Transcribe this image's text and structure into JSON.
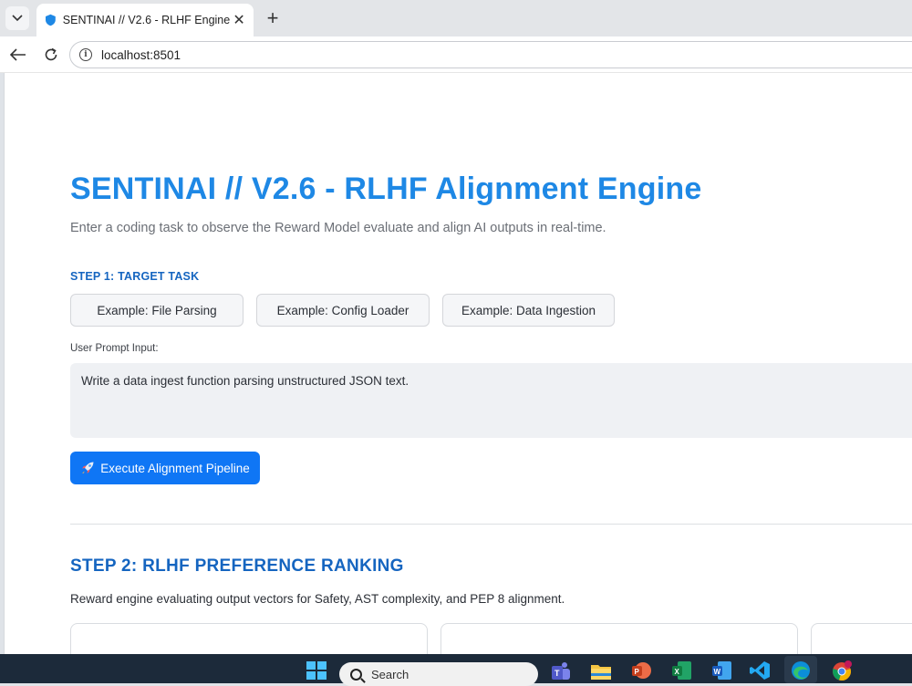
{
  "browser": {
    "tab_title": "SENTINAI // V2.6 - RLHF Engine",
    "tab_close": "✕",
    "new_tab": "+",
    "url": "localhost:8501",
    "accent": "#1a73e8"
  },
  "page": {
    "title": "SENTINAI // V2.6 - RLHF Alignment Engine",
    "subtitle": "Enter a coding task to observe the Reward Model evaluate and align AI outputs in real-time.",
    "step1_label": "STEP 1: TARGET TASK",
    "examples": [
      {
        "label": "Example: File Parsing"
      },
      {
        "label": "Example: Config Loader"
      },
      {
        "label": "Example: Data Ingestion"
      }
    ],
    "prompt_label": "User Prompt Input:",
    "prompt_value": "Write a data ingest function parsing unstructured JSON text.",
    "execute_label": "Execute Alignment Pipeline",
    "step2_title": "STEP 2: RLHF PREFERENCE RANKING",
    "step2_desc": "Reward engine evaluating output vectors for Safety, AST complexity, and PEP 8 alignment.",
    "title_color": "#1e88e5",
    "primary_button_color": "#0f76f5"
  },
  "taskbar": {
    "search_placeholder": "Search",
    "apps": [
      "windows-start-icon",
      "teams-icon",
      "file-explorer-icon",
      "powerpoint-icon",
      "excel-icon",
      "word-icon",
      "vscode-icon",
      "edge-icon",
      "chrome-icon"
    ]
  }
}
